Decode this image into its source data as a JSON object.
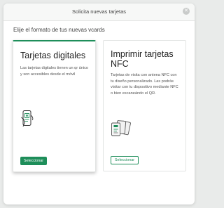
{
  "modal": {
    "title": "Solicita nuevas tarjetas",
    "subtitle": "Elije el formato de tus nuevas vcards"
  },
  "cards": [
    {
      "title": "Tarjetas digitales",
      "description": "Las tarjetas digitales tienen un qr único y son accesibles desde el móvil",
      "button_label": "Seleccionar",
      "icon": "phone-qr-icon"
    },
    {
      "title": "Imprimir tarjetas NFC",
      "description": "Tarjetas de visita con antena NFC con tu diseño personalizado. Las podrás visitar con tu dispositivo mediante NFC o bien escaneándo el QR.",
      "button_label": "Seleccionar",
      "icon": "nfc-cards-icon"
    }
  ],
  "colors": {
    "accent": "#1e8e5a",
    "header_bg": "#f7f8f7",
    "background": "#e9ebea"
  }
}
